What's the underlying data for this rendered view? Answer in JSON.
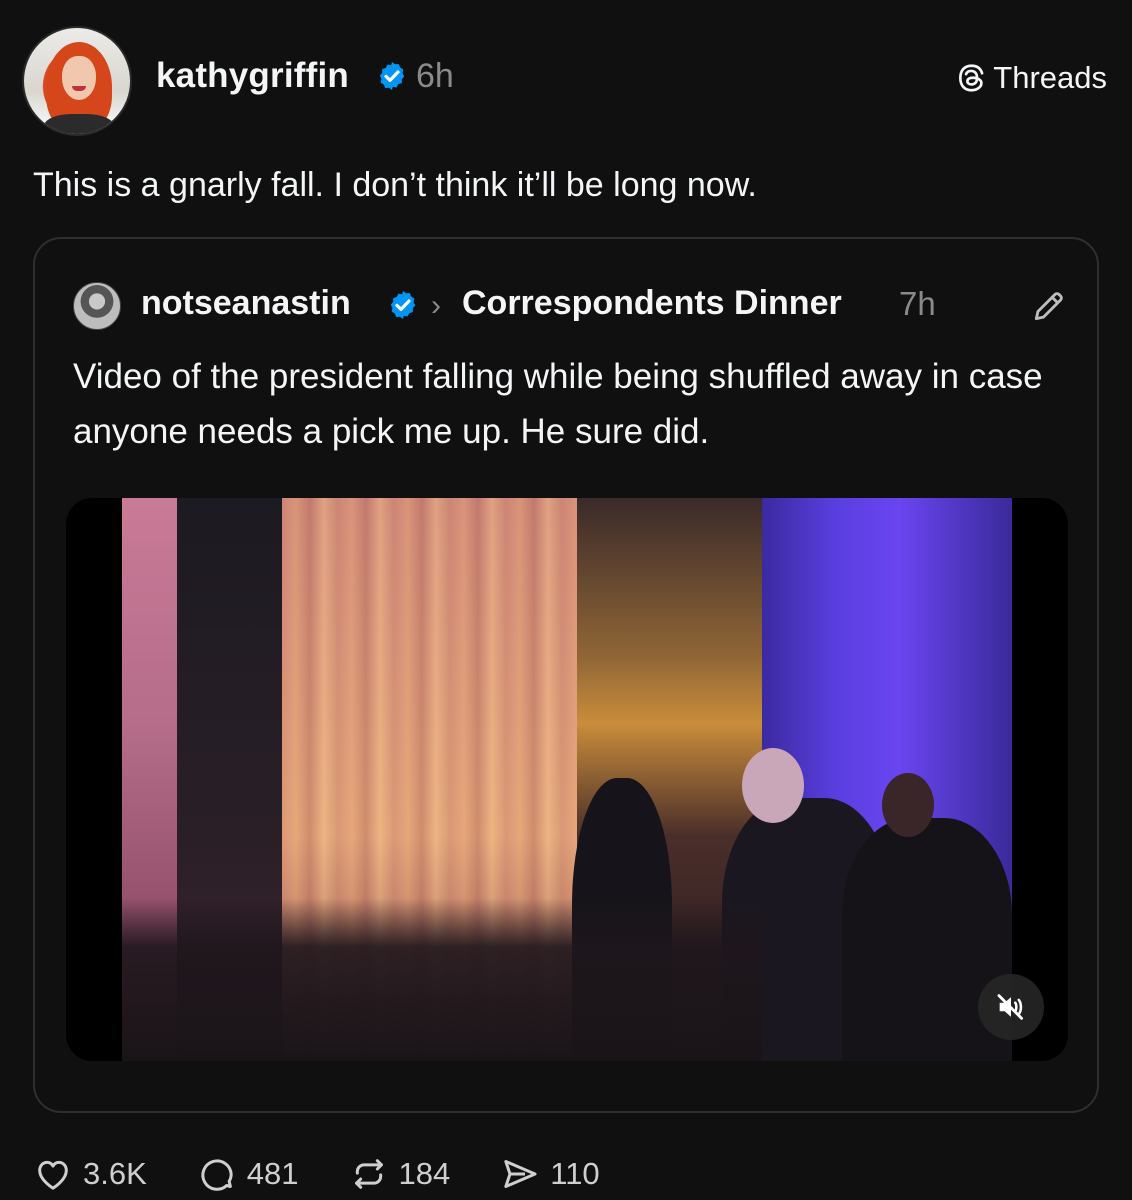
{
  "post": {
    "author": "kathygriffin",
    "time": "6h",
    "app_label": "Threads",
    "text": "This is a gnarly fall. I don’t think it’ll be long now."
  },
  "quoted_post": {
    "author": "notseanastin",
    "chevron": "›",
    "topic": "Correspondents Dinner",
    "time": "7h",
    "text": "Video of the president falling while being shuffled away in case anyone needs a pick me up. He sure did."
  },
  "icons": {
    "verified": "verified-badge-icon",
    "threads": "threads-logo-icon",
    "edit": "pencil-icon",
    "mute": "muted-speaker-icon",
    "like": "heart-icon",
    "reply": "speech-bubble-icon",
    "repost": "repost-icon",
    "share": "paper-plane-icon"
  },
  "colors": {
    "background": "#101010",
    "text": "#f3f5f7",
    "muted": "#8a8a8a",
    "verified": "#0095f6",
    "border": "#2f2f2f"
  },
  "actions": {
    "likes": "3.6K",
    "replies": "481",
    "reposts": "184",
    "shares": "110"
  }
}
